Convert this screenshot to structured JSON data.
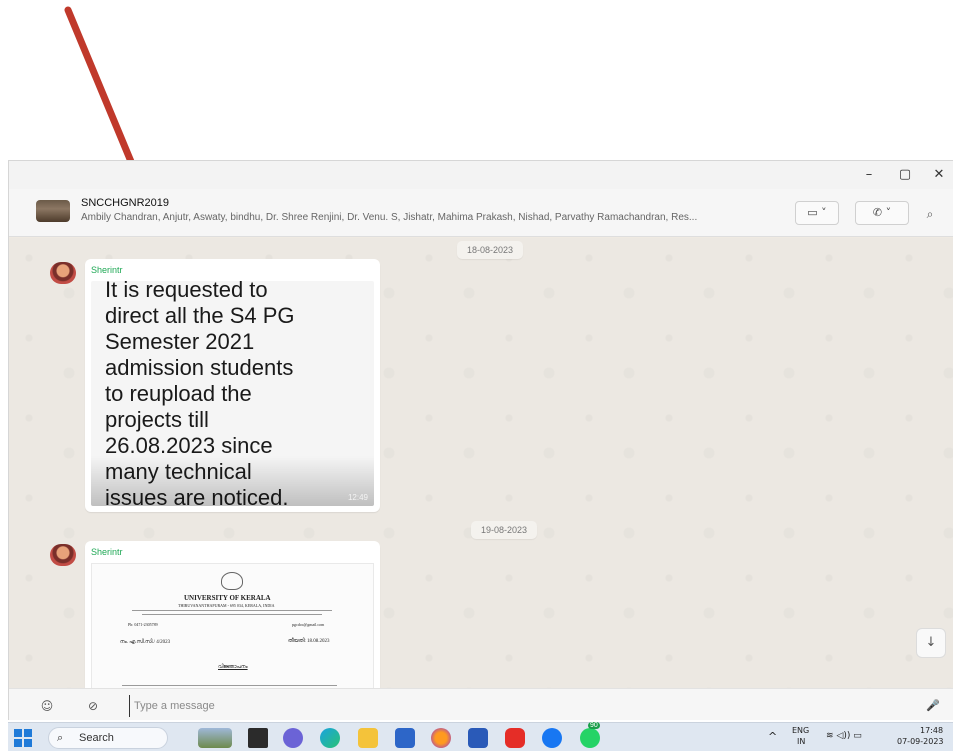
{
  "window_controls": {
    "minimize": "–",
    "maximize": "▢",
    "close": "✕"
  },
  "chat": {
    "group_name": "SNCCHGNR2019",
    "members": "Ambily Chandran, Anjutr, Aswaty, bindhu, Dr. Shree Renjini, Dr. Venu. S, Jishatr, Mahima Prakash, Nishad, Parvathy Ramachandran, Res...",
    "video_call_icon": "video-icon",
    "video_call_label": "▭ ˅",
    "voice_call_icon": "phone-icon",
    "voice_call_label": "✆ ˅",
    "search_icon": "⌕"
  },
  "messages": [
    {
      "date": "18-08-2023",
      "sender": "Sherintr",
      "image_text": "It is requested to\ndirect all the S4 PG\nSemester 2021\nadmission students\nto reupload the\nprojects till\n26.08.2023 since\nmany technical\nissues are noticed.",
      "time": "12:49"
    },
    {
      "date": "19-08-2023",
      "sender": "Sherintr",
      "document": {
        "heading": "UNIVERSITY OF KERALA",
        "subheading": "THIRUVANANTHAPURAM - 695 034, KERALA, INDIA",
        "ref_no": "നം. എ.സി.സി./ 4/2023",
        "date": "തീയതി: 18.08.2023",
        "email": "pgcdoc@gmail.com",
        "phone": "Ph: 0471-2305789",
        "subject": "വിജ്ഞാപനം"
      }
    }
  ],
  "composer": {
    "placeholder": "Type a message",
    "emoji_icon": "☺",
    "attach_icon": "⊘",
    "mic_icon": "🎤"
  },
  "scroll_down_icon": "↓",
  "taskbar": {
    "search_label": "Search",
    "search_icon": "⌕",
    "apps": [
      "landscape-widget",
      "file-explorer",
      "chat",
      "edge",
      "folder",
      "store",
      "firefox",
      "word",
      "youtube",
      "facebook",
      "whatsapp"
    ],
    "whatsapp_badge": "90",
    "tray": {
      "chevron": "^",
      "lang_top": "ENG",
      "lang_bottom": "IN",
      "status_icons": "≋ ◁)) ▭",
      "time": "17:48",
      "date": "07-09-2023"
    }
  }
}
